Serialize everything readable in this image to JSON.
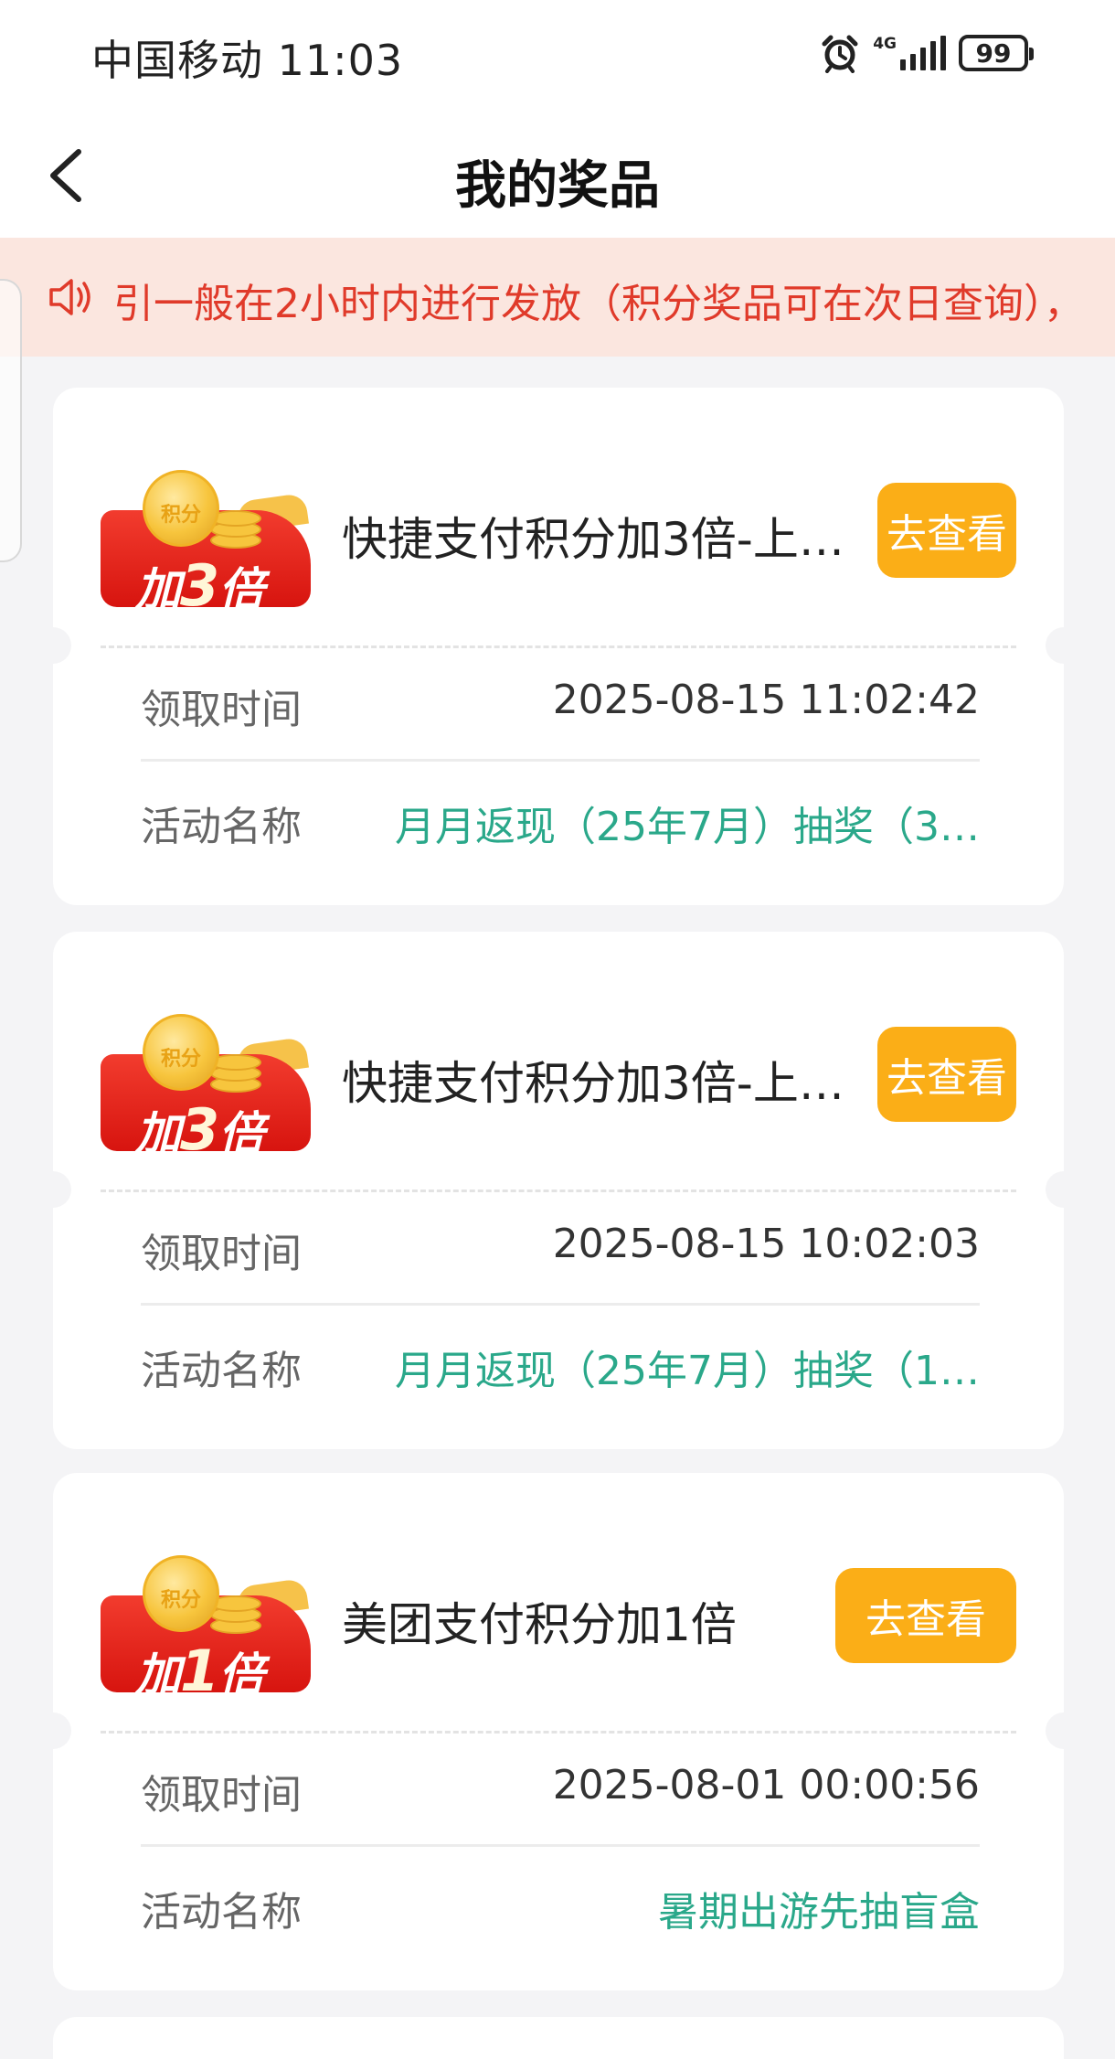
{
  "status_bar": {
    "carrier_time": "中国移动 11:03",
    "network": "4G",
    "battery": "99"
  },
  "nav": {
    "title": "我的奖品"
  },
  "notice": {
    "text": "引一般在2小时内进行发放（积分奖品可在次日查询），"
  },
  "labels": {
    "claim_time": "领取时间",
    "activity_name": "活动名称"
  },
  "prizes": [
    {
      "badge_prefix": "加",
      "badge_number": "3",
      "badge_suffix": "倍",
      "coin_label": "积分",
      "title": "快捷支付积分加3倍-上…",
      "button": "去查看",
      "claim_time": "2025-08-15 11:02:42",
      "activity": "月月返现（25年7月）抽奖（3…"
    },
    {
      "badge_prefix": "加",
      "badge_number": "3",
      "badge_suffix": "倍",
      "coin_label": "积分",
      "title": "快捷支付积分加3倍-上…",
      "button": "去查看",
      "claim_time": "2025-08-15 10:02:03",
      "activity": "月月返现（25年7月）抽奖（1…"
    },
    {
      "badge_prefix": "加",
      "badge_number": "1",
      "badge_suffix": "倍",
      "coin_label": "积分",
      "title": "美团支付积分加1倍",
      "button": "去查看",
      "claim_time": "2025-08-01 00:00:56",
      "activity": "暑期出游先抽盲盒"
    }
  ],
  "colors": {
    "accent_button": "#fbae17",
    "notice_text": "#e03a2a",
    "activity_link": "#2aa88a"
  }
}
